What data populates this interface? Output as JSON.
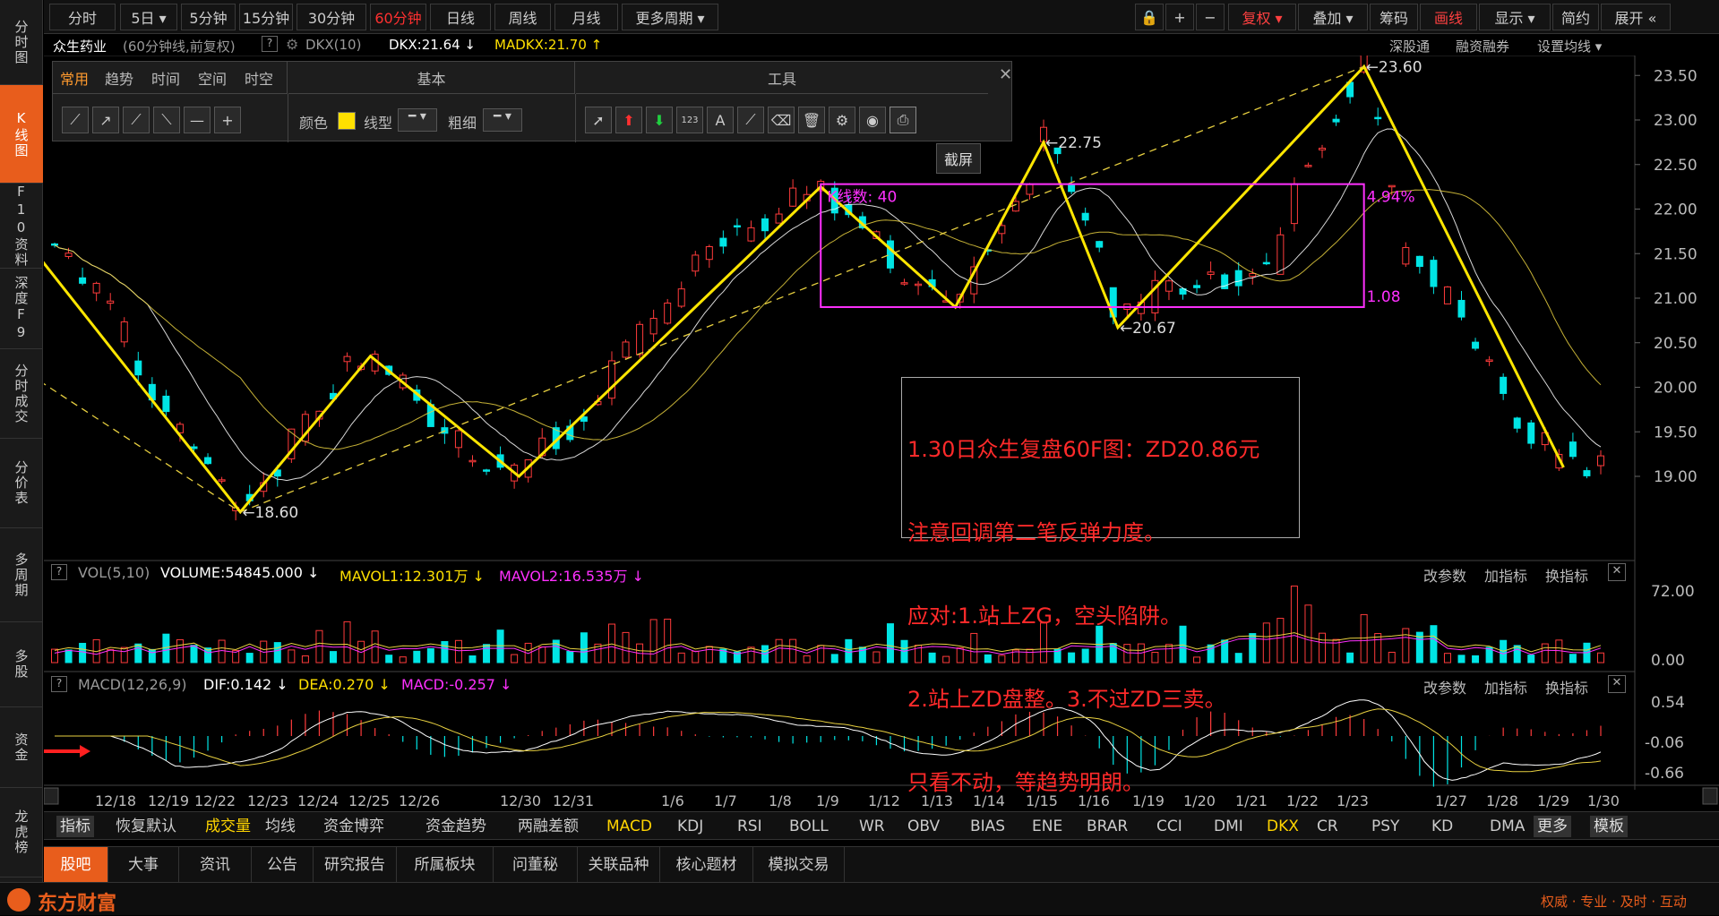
{
  "sidebar": [
    {
      "label": "分时图",
      "active": false
    },
    {
      "label": "K线图",
      "active": true
    },
    {
      "label": "F10资料",
      "active": false
    },
    {
      "label": "深度F9",
      "active": false
    },
    {
      "label": "分时成交",
      "active": false
    },
    {
      "label": "分价表",
      "active": false
    },
    {
      "label": "多周期",
      "active": false
    },
    {
      "label": "多股",
      "active": false
    },
    {
      "label": "资金",
      "active": false
    },
    {
      "label": "龙虎榜",
      "active": false
    }
  ],
  "toolbar": {
    "periods": [
      "分时",
      "5日 ▾",
      "5分钟",
      "15分钟",
      "30分钟",
      "60分钟",
      "日线",
      "周线",
      "月线",
      "更多周期 ▾"
    ],
    "active_period": "60分钟",
    "right_buttons": [
      "复权 ▾",
      "叠加 ▾",
      "筹码",
      "画线",
      "显示 ▾",
      "简约",
      "展开 «"
    ],
    "lock_icon": "lock-icon",
    "plus": "+",
    "minus": "−"
  },
  "info": {
    "stock": "众生药业",
    "period_desc": "(60分钟线,前复权)",
    "help": "?",
    "indicator": "DKX(10)",
    "dkx": "DKX:21.64 ↓",
    "madkx": "MADKX:21.70 ↑",
    "right_links": [
      "深股通",
      "融资融券",
      "设置均线 ▾"
    ]
  },
  "draw_panel": {
    "tabs": [
      "常用",
      "趋势",
      "时间",
      "空间",
      "时空"
    ],
    "active_tab": "常用",
    "section_basic": "基本",
    "section_tools": "工具",
    "color_label": "颜色",
    "linetype_label": "线型",
    "thickness_label": "粗细",
    "tooltip": "截屏",
    "close": "✕"
  },
  "annotation": {
    "lines": [
      "1.30日众生复盘60F图：ZD20.86元",
      "注意回调第二笔反弹力度。",
      "应对:1.站上ZG，空头陷阱。",
      "2.站上ZD盘整。3.不过ZD三卖。",
      "只看不动，等趋势明朗。"
    ]
  },
  "chart_labels": {
    "low1": "18.60",
    "high1": "22.75",
    "low2": "20.67",
    "high2": "23.60",
    "kcount": "K线数: 40",
    "pct": "4.94%",
    "diff": "1.08"
  },
  "price_axis": [
    "23.50",
    "23.00",
    "22.50",
    "22.00",
    "21.50",
    "21.00",
    "20.50",
    "20.00",
    "19.50",
    "19.00"
  ],
  "vol": {
    "help": "?",
    "name": "VOL(5,10)",
    "volume": "VOLUME:54845.000 ↓",
    "mavol1": "MAVOL1:12.301万 ↓",
    "mavol2": "MAVOL2:16.535万 ↓",
    "axis": [
      "72.00",
      "0.00"
    ],
    "actions": [
      "改参数",
      "加指标",
      "换指标"
    ]
  },
  "macd": {
    "help": "?",
    "name": "MACD(12,26,9)",
    "dif": "DIF:0.142 ↓",
    "dea": "DEA:0.270 ↓",
    "macd": "MACD:-0.257 ↓",
    "axis": [
      "0.54",
      "-0.06",
      "-0.66"
    ],
    "actions": [
      "改参数",
      "加指标",
      "换指标"
    ]
  },
  "date_axis": [
    "12/18",
    "12/19",
    "12/22",
    "12/23",
    "12/24",
    "12/25",
    "12/26",
    "12/30",
    "12/31",
    "1/6",
    "1/7",
    "1/8",
    "1/9",
    "1/12",
    "1/13",
    "1/14",
    "1/15",
    "1/16",
    "1/19",
    "1/20",
    "1/21",
    "1/22",
    "1/23",
    "1/27",
    "1/28",
    "1/29",
    "1/30"
  ],
  "indicator_bar": {
    "items": [
      "指标",
      "恢复默认",
      "成交量",
      "均线",
      "资金博弈",
      "资金趋势",
      "两融差额",
      "MACD",
      "KDJ",
      "RSI",
      "BOLL",
      "WR",
      "OBV",
      "BIAS",
      "ENE",
      "BRAR",
      "CCI",
      "DMI",
      "DKX",
      "CR",
      "PSY",
      "KD",
      "DMA",
      "更多",
      "模板"
    ],
    "selected": [
      "成交量",
      "MACD",
      "DKX"
    ]
  },
  "tabs": [
    "股吧",
    "大事",
    "资讯",
    "公告",
    "研究报告",
    "所属板块",
    "问董秘",
    "关联品种",
    "核心题材",
    "模拟交易"
  ],
  "active_tab": "股吧",
  "footer": {
    "brand": "东方财富",
    "slogan": "权威 · 专业 · 及时 · 互动"
  },
  "chart_data": {
    "type": "candlestick",
    "ylim": [
      18.8,
      23.8
    ],
    "zigzag": [
      {
        "date": "12/18",
        "price": 21.6
      },
      {
        "date": "12/22",
        "price": 18.6
      },
      {
        "date": "12/25",
        "price": 20.35
      },
      {
        "date": "12/30",
        "price": 19.0
      },
      {
        "date": "1/12",
        "price": 22.25
      },
      {
        "date": "1/15",
        "price": 20.9
      },
      {
        "date": "1/19",
        "price": 22.75
      },
      {
        "date": "1/20",
        "price": 20.67
      },
      {
        "date": "1/26",
        "price": 23.6
      },
      {
        "date": "1/30",
        "price": 19.1
      }
    ],
    "zhongshu_box": {
      "top": 22.28,
      "bottom": 20.9,
      "start": "1/12",
      "end": "1/26"
    }
  }
}
